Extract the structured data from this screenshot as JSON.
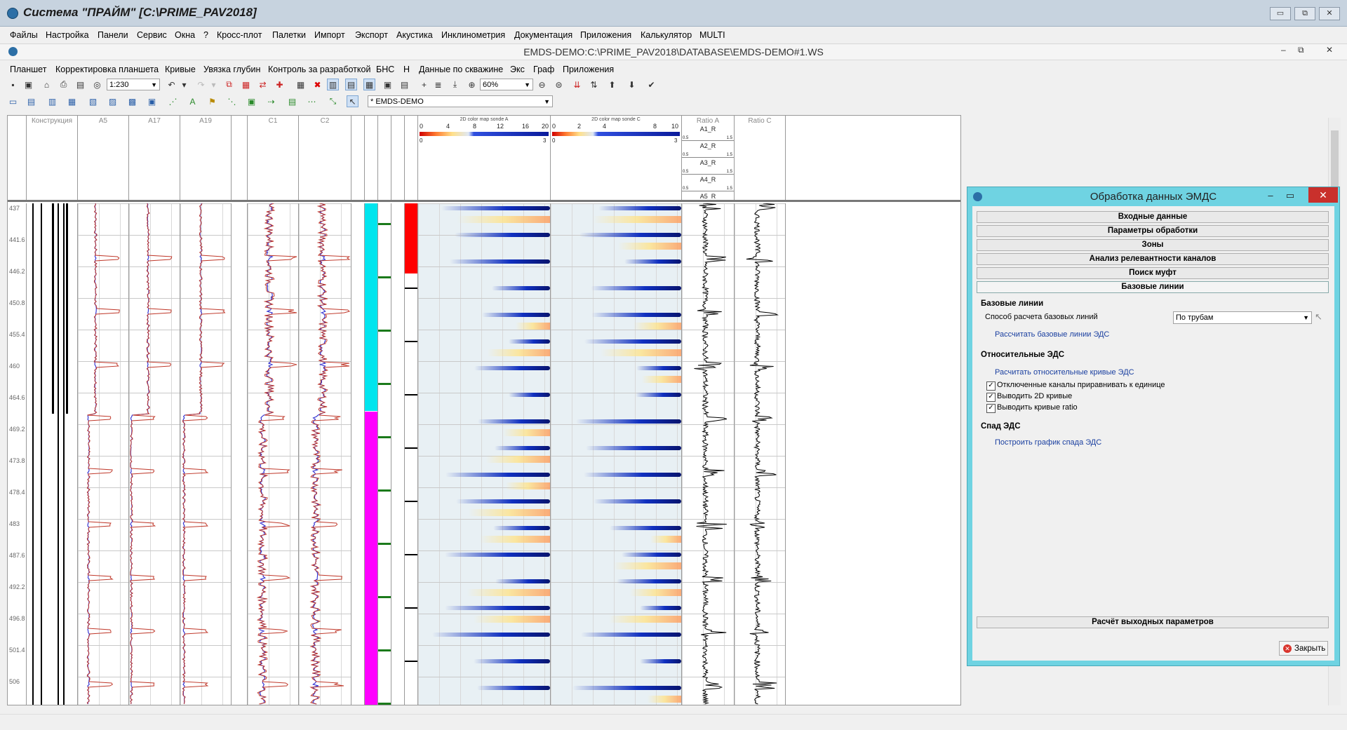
{
  "app": {
    "title": "Система \"ПРАЙМ\" [C:\\PRIME_PAV2018]",
    "window_controls": [
      "▭",
      "⧉",
      "✕"
    ]
  },
  "main_menu": [
    "Файлы",
    "Настройка",
    "Панели",
    "Сервис",
    "Окна",
    "?",
    "Кросс-плот",
    "Палетки",
    "Импорт",
    "Экспорт",
    "Акустика",
    "Инклинометрия",
    "Документация",
    "Приложения",
    "Калькулятор",
    "MULTI"
  ],
  "mdi": {
    "title": "EMDS-DEMO:C:\\PRIME_PAV2018\\DATABASE\\EMDS-DEMO#1.WS",
    "controls": [
      "–",
      "⧉",
      "✕"
    ]
  },
  "plan_menu": [
    "Планшет",
    "Корректировка планшета",
    "Кривые",
    "Увязка глубин",
    "Контроль за разработкой",
    "БНС",
    "Н",
    "Данные по скважине",
    "Экс",
    "Граф",
    "Приложения"
  ],
  "toolbar": {
    "scale_value": "1:230",
    "zoom_value": "60%",
    "dataset_value": "* EMDS-DEMO"
  },
  "tracks": {
    "headers": [
      "Конструкция",
      "A5",
      "A17",
      "A19",
      "C1",
      "C2",
      "Ratio A",
      "Ratio C"
    ],
    "map_a": {
      "title": "2D color map sonde A",
      "ticks": [
        "0",
        "4",
        "8",
        "12",
        "16",
        "20"
      ],
      "min": "0",
      "max": "3"
    },
    "map_c": {
      "title": "2D color map sonde C",
      "ticks": [
        "0",
        "2",
        "4",
        "8",
        "10"
      ],
      "min": "0",
      "max": "3"
    },
    "ratio_curves": [
      {
        "name": "A1_R",
        "min": "0.5",
        "max": "1.5"
      },
      {
        "name": "A2_R",
        "min": "0.5",
        "max": "1.5"
      },
      {
        "name": "A3_R",
        "min": "0.5",
        "max": "1.5"
      },
      {
        "name": "A4_R",
        "min": "0.5",
        "max": "1.5"
      },
      {
        "name": "A5_R",
        "min": "",
        "max": ""
      }
    ],
    "depths": [
      "437",
      "441.6",
      "446.2",
      "450.8",
      "455.4",
      "460",
      "464.6",
      "469.2",
      "473.8",
      "478.4",
      "483",
      "487.6",
      "492.2",
      "496.8",
      "501.4",
      "506"
    ]
  },
  "dialog": {
    "title": "Обработка данных ЭМДС",
    "controls": [
      "–",
      "▭",
      "✕"
    ],
    "accordion": [
      "Входные данные",
      "Параметры обработки",
      "Зоны",
      "Анализ релевантности каналов",
      "Поиск муфт",
      "Базовые линии"
    ],
    "section_baselines": "Базовые линии",
    "baseline_method_label": "Способ расчета базовых линий",
    "baseline_method_value": "По трубам",
    "link_calc_baselines": "Рассчитать базовые линии ЭДС",
    "section_relative": "Относительные ЭДС",
    "link_calc_relative": "Расчитать относительные кривые ЭДС",
    "checkboxes": [
      {
        "label": "Отключенные каналы приравнивать к единице",
        "checked": true
      },
      {
        "label": "Выводить 2D кривые",
        "checked": true
      },
      {
        "label": "Выводить кривые ratio",
        "checked": true
      }
    ],
    "section_decay": "Спад ЭДС",
    "link_decay_plot": "Построить график спада ЭДС",
    "calc_output_button": "Расчёт выходных параметров",
    "close_button": "Закрыть"
  },
  "colors": {
    "cyan_zone": "#00e5ee",
    "magenta_zone": "#ff00ff",
    "red_zone": "#ff0000",
    "curve_red": "#c0392b",
    "curve_blue": "#2a2ad0",
    "dialog_frame": "#6fd3e2"
  }
}
